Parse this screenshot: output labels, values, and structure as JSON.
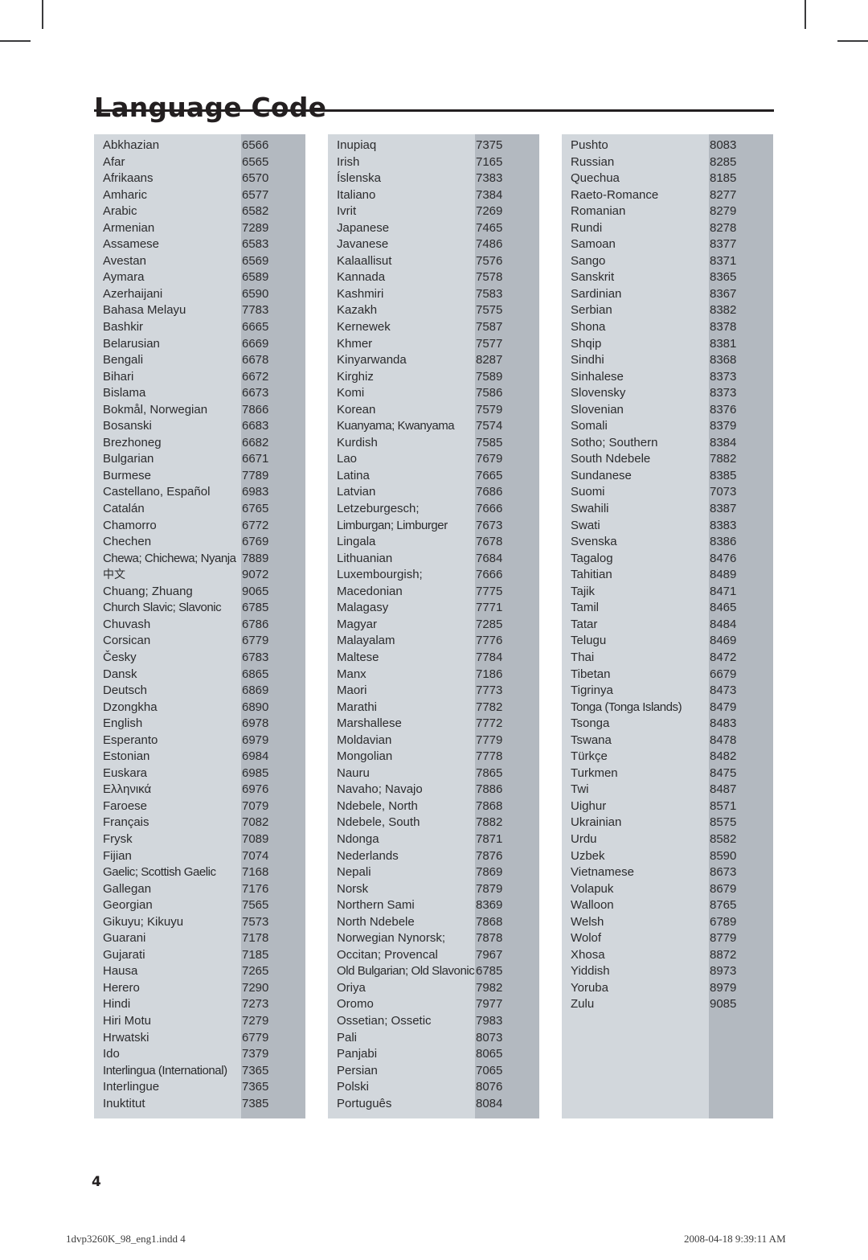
{
  "page": {
    "title": "Language Code",
    "number": "4",
    "footer_file": "1dvp3260K_98_eng1.indd   4",
    "footer_timestamp": "2008-04-18   9:39:11 AM"
  },
  "theme": {
    "name_band": "#d2d7dc",
    "code_band": "#b3b9c0",
    "text": "#2b2b2d",
    "rule": "#231f20"
  },
  "columns": [
    {
      "id": "column-1",
      "rows": [
        {
          "name": "Abkhazian",
          "code": "6566"
        },
        {
          "name": "Afar",
          "code": "6565"
        },
        {
          "name": "Afrikaans",
          "code": "6570"
        },
        {
          "name": "Amharic",
          "code": "6577"
        },
        {
          "name": "Arabic",
          "code": "6582"
        },
        {
          "name": "Armenian",
          "code": "7289"
        },
        {
          "name": "Assamese",
          "code": "6583"
        },
        {
          "name": "Avestan",
          "code": "6569"
        },
        {
          "name": "Aymara",
          "code": "6589"
        },
        {
          "name": "Azerhaijani",
          "code": "6590"
        },
        {
          "name": "Bahasa Melayu",
          "code": "7783"
        },
        {
          "name": "Bashkir",
          "code": "6665"
        },
        {
          "name": "Belarusian",
          "code": "6669"
        },
        {
          "name": "Bengali",
          "code": "6678"
        },
        {
          "name": "Bihari",
          "code": "6672"
        },
        {
          "name": "Bislama",
          "code": "6673"
        },
        {
          "name": "Bokmål, Norwegian",
          "code": "7866"
        },
        {
          "name": "Bosanski",
          "code": "6683"
        },
        {
          "name": "Brezhoneg",
          "code": "6682"
        },
        {
          "name": "Bulgarian",
          "code": "6671"
        },
        {
          "name": "Burmese",
          "code": "7789"
        },
        {
          "name": "Castellano, Español",
          "code": "6983"
        },
        {
          "name": "Catalán",
          "code": "6765"
        },
        {
          "name": "Chamorro",
          "code": "6772"
        },
        {
          "name": "Chechen",
          "code": "6769"
        },
        {
          "name": "Chewa; Chichewa; Nyanja",
          "code": "7889",
          "tight": true
        },
        {
          "name": "中文",
          "code": "9072",
          "cjk": true
        },
        {
          "name": "Chuang; Zhuang",
          "code": "9065"
        },
        {
          "name": "Church Slavic; Slavonic",
          "code": "6785",
          "tight": true
        },
        {
          "name": "Chuvash",
          "code": "6786"
        },
        {
          "name": "Corsican",
          "code": "6779"
        },
        {
          "name": "Česky",
          "code": "6783"
        },
        {
          "name": "Dansk",
          "code": "6865"
        },
        {
          "name": "Deutsch",
          "code": "6869"
        },
        {
          "name": "Dzongkha",
          "code": "6890"
        },
        {
          "name": "English",
          "code": "6978"
        },
        {
          "name": "Esperanto",
          "code": "6979"
        },
        {
          "name": "Estonian",
          "code": "6984"
        },
        {
          "name": "Euskara",
          "code": "6985"
        },
        {
          "name": "Ελληνικά",
          "code": "6976"
        },
        {
          "name": "Faroese",
          "code": "7079"
        },
        {
          "name": "Français",
          "code": "7082"
        },
        {
          "name": "Frysk",
          "code": "7089"
        },
        {
          "name": "Fijian",
          "code": "7074"
        },
        {
          "name": "Gaelic; Scottish Gaelic",
          "code": "7168",
          "tight": true
        },
        {
          "name": "Gallegan",
          "code": "7176"
        },
        {
          "name": "Georgian",
          "code": "7565"
        },
        {
          "name": "Gikuyu; Kikuyu",
          "code": "7573"
        },
        {
          "name": "Guarani",
          "code": "7178"
        },
        {
          "name": "Gujarati",
          "code": "7185"
        },
        {
          "name": "Hausa",
          "code": "7265"
        },
        {
          "name": "Herero",
          "code": "7290"
        },
        {
          "name": "Hindi",
          "code": "7273"
        },
        {
          "name": "Hiri Motu",
          "code": "7279"
        },
        {
          "name": "Hrwatski",
          "code": "6779"
        },
        {
          "name": "Ido",
          "code": "7379"
        },
        {
          "name": "Interlingua (International)",
          "code": "7365",
          "tight": true
        },
        {
          "name": "Interlingue",
          "code": "7365"
        },
        {
          "name": "Inuktitut",
          "code": "7385"
        }
      ]
    },
    {
      "id": "column-2",
      "rows": [
        {
          "name": "Inupiaq",
          "code": "7375"
        },
        {
          "name": "Irish",
          "code": "7165"
        },
        {
          "name": "Íslenska",
          "code": "7383"
        },
        {
          "name": "Italiano",
          "code": "7384"
        },
        {
          "name": "Ivrit",
          "code": "7269"
        },
        {
          "name": "Japanese",
          "code": "7465"
        },
        {
          "name": "Javanese",
          "code": "7486"
        },
        {
          "name": "Kalaallisut",
          "code": "7576"
        },
        {
          "name": "Kannada",
          "code": "7578"
        },
        {
          "name": "Kashmiri",
          "code": "7583"
        },
        {
          "name": "Kazakh",
          "code": "7575"
        },
        {
          "name": "Kernewek",
          "code": "7587"
        },
        {
          "name": "Khmer",
          "code": "7577"
        },
        {
          "name": "Kinyarwanda",
          "code": "8287"
        },
        {
          "name": "Kirghiz",
          "code": "7589"
        },
        {
          "name": "Komi",
          "code": "7586"
        },
        {
          "name": "Korean",
          "code": "7579"
        },
        {
          "name": "Kuanyama; Kwanyama",
          "code": "7574",
          "tight": true
        },
        {
          "name": "Kurdish",
          "code": "7585"
        },
        {
          "name": "Lao",
          "code": "7679"
        },
        {
          "name": "Latina",
          "code": "7665"
        },
        {
          "name": "Latvian",
          "code": "7686"
        },
        {
          "name": "Letzeburgesch;",
          "code": "7666"
        },
        {
          "name": "Limburgan; Limburger",
          "code": "7673",
          "tight": true
        },
        {
          "name": "Lingala",
          "code": "7678"
        },
        {
          "name": "Lithuanian",
          "code": "7684"
        },
        {
          "name": "Luxembourgish;",
          "code": "7666"
        },
        {
          "name": "Macedonian",
          "code": "7775"
        },
        {
          "name": "Malagasy",
          "code": "7771"
        },
        {
          "name": "Magyar",
          "code": "7285"
        },
        {
          "name": "Malayalam",
          "code": "7776"
        },
        {
          "name": "Maltese",
          "code": "7784"
        },
        {
          "name": "Manx",
          "code": "7186"
        },
        {
          "name": "Maori",
          "code": "7773"
        },
        {
          "name": "Marathi",
          "code": "7782"
        },
        {
          "name": "Marshallese",
          "code": "7772"
        },
        {
          "name": "Moldavian",
          "code": "7779"
        },
        {
          "name": "Mongolian",
          "code": "7778"
        },
        {
          "name": "Nauru",
          "code": "7865"
        },
        {
          "name": "Navaho; Navajo",
          "code": "7886"
        },
        {
          "name": "Ndebele, North",
          "code": "7868"
        },
        {
          "name": "Ndebele, South",
          "code": "7882"
        },
        {
          "name": "Ndonga",
          "code": "7871"
        },
        {
          "name": "Nederlands",
          "code": "7876"
        },
        {
          "name": "Nepali",
          "code": "7869"
        },
        {
          "name": "Norsk",
          "code": "7879"
        },
        {
          "name": "Northern Sami",
          "code": "8369"
        },
        {
          "name": "North Ndebele",
          "code": "7868"
        },
        {
          "name": "Norwegian Nynorsk;",
          "code": "7878"
        },
        {
          "name": "Occitan; Provencal",
          "code": "7967"
        },
        {
          "name": "Old Bulgarian; Old Slavonic",
          "code": "6785",
          "tight": true
        },
        {
          "name": "Oriya",
          "code": "7982"
        },
        {
          "name": "Oromo",
          "code": "7977"
        },
        {
          "name": "Ossetian; Ossetic",
          "code": "7983"
        },
        {
          "name": "Pali",
          "code": "8073"
        },
        {
          "name": "Panjabi",
          "code": "8065"
        },
        {
          "name": "Persian",
          "code": "7065"
        },
        {
          "name": "Polski",
          "code": "8076"
        },
        {
          "name": "Português",
          "code": "8084"
        }
      ]
    },
    {
      "id": "column-3",
      "rows": [
        {
          "name": "Pushto",
          "code": "8083"
        },
        {
          "name": "Russian",
          "code": "8285"
        },
        {
          "name": "Quechua",
          "code": "8185"
        },
        {
          "name": "Raeto-Romance",
          "code": "8277"
        },
        {
          "name": "Romanian",
          "code": "8279"
        },
        {
          "name": "Rundi",
          "code": "8278"
        },
        {
          "name": "Samoan",
          "code": "8377"
        },
        {
          "name": "Sango",
          "code": "8371"
        },
        {
          "name": "Sanskrit",
          "code": "8365"
        },
        {
          "name": "Sardinian",
          "code": "8367"
        },
        {
          "name": "Serbian",
          "code": "8382"
        },
        {
          "name": "Shona",
          "code": "8378"
        },
        {
          "name": "Shqip",
          "code": "8381"
        },
        {
          "name": "Sindhi",
          "code": "8368"
        },
        {
          "name": "Sinhalese",
          "code": "8373"
        },
        {
          "name": "Slovensky",
          "code": "8373"
        },
        {
          "name": "Slovenian",
          "code": "8376"
        },
        {
          "name": "Somali",
          "code": "8379"
        },
        {
          "name": "Sotho; Southern",
          "code": "8384"
        },
        {
          "name": "South Ndebele",
          "code": "7882"
        },
        {
          "name": "Sundanese",
          "code": "8385"
        },
        {
          "name": "Suomi",
          "code": "7073"
        },
        {
          "name": "Swahili",
          "code": "8387"
        },
        {
          "name": "Swati",
          "code": "8383"
        },
        {
          "name": "Svenska",
          "code": "8386"
        },
        {
          "name": "Tagalog",
          "code": "8476"
        },
        {
          "name": "Tahitian",
          "code": "8489"
        },
        {
          "name": "Tajik",
          "code": "8471"
        },
        {
          "name": "Tamil",
          "code": "8465"
        },
        {
          "name": "Tatar",
          "code": "8484"
        },
        {
          "name": "Telugu",
          "code": "8469"
        },
        {
          "name": "Thai",
          "code": "8472"
        },
        {
          "name": "Tibetan",
          "code": "6679"
        },
        {
          "name": "Tigrinya",
          "code": "8473"
        },
        {
          "name": "Tonga (Tonga Islands)",
          "code": "8479",
          "tight": true
        },
        {
          "name": "Tsonga",
          "code": "8483"
        },
        {
          "name": "Tswana",
          "code": "8478"
        },
        {
          "name": "Türkçe",
          "code": "8482"
        },
        {
          "name": "Turkmen",
          "code": "8475"
        },
        {
          "name": "Twi",
          "code": "8487"
        },
        {
          "name": "Uighur",
          "code": "8571"
        },
        {
          "name": "Ukrainian",
          "code": "8575"
        },
        {
          "name": "Urdu",
          "code": "8582"
        },
        {
          "name": "Uzbek",
          "code": "8590"
        },
        {
          "name": "Vietnamese",
          "code": "8673"
        },
        {
          "name": "Volapuk",
          "code": "8679"
        },
        {
          "name": "Walloon",
          "code": "8765"
        },
        {
          "name": "Welsh",
          "code": "6789"
        },
        {
          "name": "Wolof",
          "code": "8779"
        },
        {
          "name": "Xhosa",
          "code": "8872"
        },
        {
          "name": "Yiddish",
          "code": "8973"
        },
        {
          "name": "Yoruba",
          "code": "8979"
        },
        {
          "name": "Zulu",
          "code": "9085"
        }
      ]
    }
  ]
}
